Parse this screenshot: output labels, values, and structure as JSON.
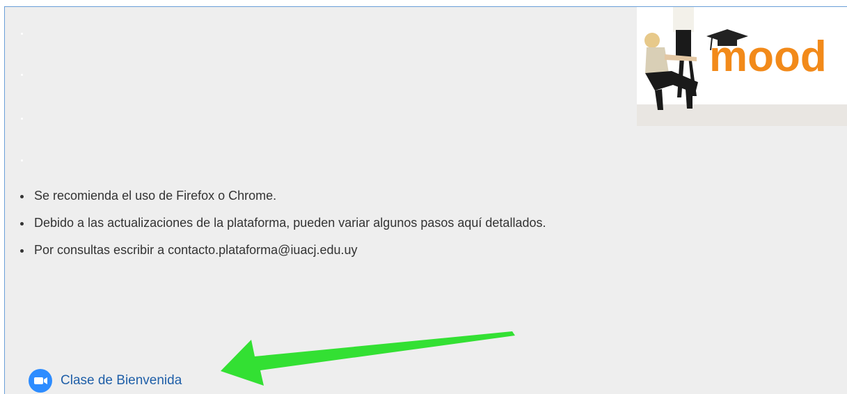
{
  "banner": {
    "logo_text": "mood",
    "colors": {
      "logo_orange": "#f28a1a",
      "cap": "#222222"
    }
  },
  "notes": [
    "Se recomienda el uso de Firefox o Chrome.",
    "Debido a las actualizaciones de la plataforma, pueden variar algunos pasos aquí detallados.",
    "Por consultas escribir a contacto.plataforma@iuacj.edu.uy"
  ],
  "activity": {
    "label": "Clase de Bienvenida",
    "icon": "zoom-video-icon",
    "icon_color": "#2d8cff"
  },
  "annotation": {
    "icon": "green-arrow-icon",
    "color": "#33e033"
  }
}
